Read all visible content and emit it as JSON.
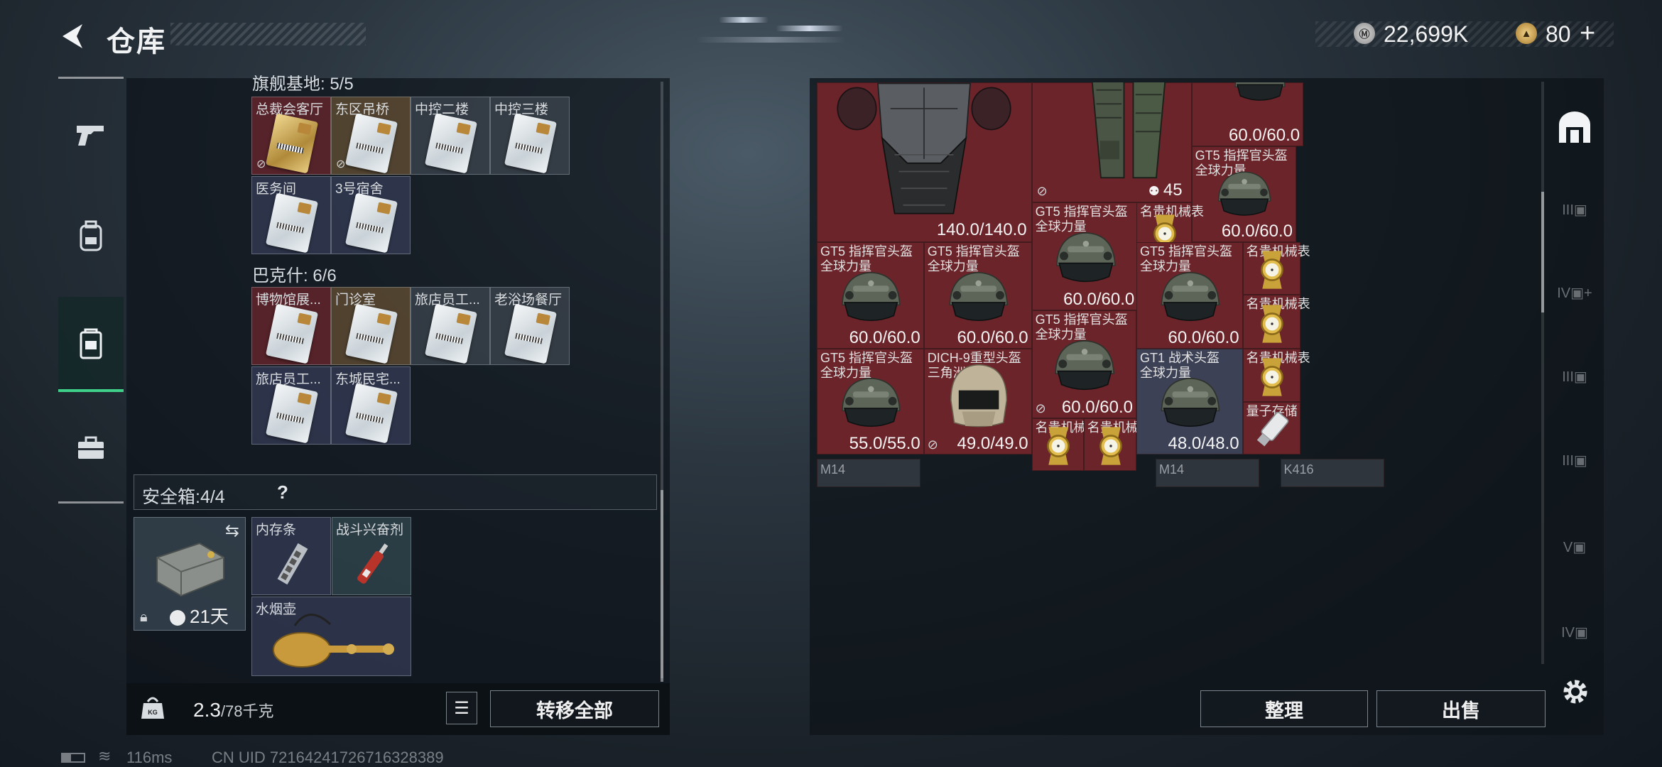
{
  "header": {
    "title": "仓库"
  },
  "currency": {
    "money": "22,699K",
    "tokens": "80"
  },
  "left_panel": {
    "partial_header": "旗舰基地: 5/5",
    "group1_cells": [
      {
        "label": "总裁会客厅",
        "gold": true,
        "bg": "red",
        "locked": true
      },
      {
        "label": "东区吊桥",
        "gold": false,
        "bg": "gold",
        "locked": true
      },
      {
        "label": "中控二楼",
        "gold": false,
        "bg": "gray",
        "locked": false
      },
      {
        "label": "中控三楼",
        "gold": false,
        "bg": "gray",
        "locked": false
      },
      {
        "label": "医务间",
        "gold": false,
        "bg": "blue",
        "locked": false
      },
      {
        "label": "3号宿舍",
        "gold": false,
        "bg": "blue",
        "locked": false
      }
    ],
    "group2_title": "巴克什: 6/6",
    "group2_cells": [
      {
        "label": "博物馆展...",
        "bg": "red"
      },
      {
        "label": "门诊室",
        "bg": "gold"
      },
      {
        "label": "旅店员工...",
        "bg": "gray"
      },
      {
        "label": "老浴场餐厅",
        "bg": "gray"
      },
      {
        "label": "旅店员工...",
        "bg": "blue"
      },
      {
        "label": "东城民宅...",
        "bg": "blue"
      }
    ],
    "safe_box": {
      "title": "安全箱:",
      "count": "4/4",
      "help": "?",
      "days": "21天",
      "items": [
        {
          "label": "内存条"
        },
        {
          "label": "战斗兴奋剂"
        },
        {
          "label": "水烟壶"
        }
      ]
    },
    "weight": {
      "current": "2.3",
      "max": "/78千克"
    },
    "transfer_all": "转移全部"
  },
  "right_panel": {
    "armor1_dur": "140.0/140.0",
    "vest_count": "45",
    "top_right_dur": "60.0/60.0",
    "items": [
      {
        "name": "GT5 指挥官头盔",
        "sub": "全球力量",
        "dur": "60.0/60.0"
      },
      {
        "name": "GT5 指挥官头盔",
        "sub": "全球力量",
        "dur": "60.0/60.0"
      },
      {
        "name": "名贵机械表",
        "sub": "",
        "dur": ""
      },
      {
        "name": "GT5 指挥官头盔",
        "sub": "全球力量",
        "dur": "60.0/60.0"
      },
      {
        "name": "GT5 指挥官头盔",
        "sub": "全球力量",
        "dur": "60.0/60.0"
      },
      {
        "name": "GT5 指挥官头盔",
        "sub": "全球力量",
        "dur": "60.0/60.0"
      },
      {
        "name": "名贵机械表",
        "sub": "",
        "dur": ""
      },
      {
        "name": "GT5 指挥官头盔",
        "sub": "全球力量",
        "dur": "60.0/60.0"
      },
      {
        "name": "名贵机械表",
        "sub": "",
        "dur": ""
      },
      {
        "name": "GT5 指挥官头盔",
        "sub": "全球力量",
        "dur": "55.0/55.0"
      },
      {
        "name": "DICH-9重型头盔",
        "sub": "三角洲",
        "dur": "49.0/49.0"
      },
      {
        "name": "名贵机械表",
        "sub": "",
        "dur": ""
      },
      {
        "name": "名贵机械表",
        "sub": "",
        "dur": ""
      },
      {
        "name": "GT1 战术头盔",
        "sub": "全球力量",
        "dur": "48.0/48.0"
      },
      {
        "name": "名贵机械表",
        "sub": "",
        "dur": ""
      },
      {
        "name": "量子存储",
        "sub": "",
        "dur": ""
      }
    ],
    "next_row": [
      "M14",
      "M14",
      "K416"
    ],
    "sort_label": "整理",
    "sell_label": "出售"
  },
  "status": {
    "ping": "116ms",
    "uid": "CN UID 7216424172671632​8389"
  }
}
